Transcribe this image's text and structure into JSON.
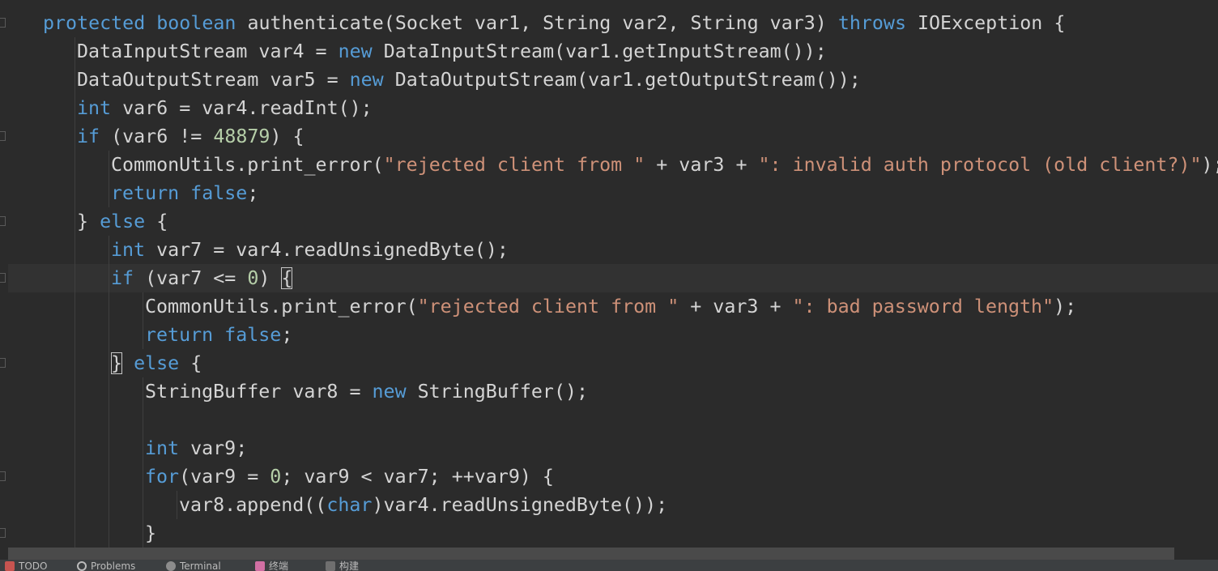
{
  "editor": {
    "lines": [
      [
        {
          "t": "protected boolean",
          "c": "kw"
        },
        {
          "t": " authenticate(Socket var1, String var2, String var3) "
        },
        {
          "t": "throws",
          "c": "kw"
        },
        {
          "t": " IOException {"
        }
      ],
      [
        {
          "t": "DataInputStream var4 = "
        },
        {
          "t": "new",
          "c": "kw"
        },
        {
          "t": " DataInputStream(var1.getInputStream());"
        }
      ],
      [
        {
          "t": "DataOutputStream var5 = "
        },
        {
          "t": "new",
          "c": "kw"
        },
        {
          "t": " DataOutputStream(var1.getOutputStream());"
        }
      ],
      [
        {
          "t": "int",
          "c": "kw"
        },
        {
          "t": " var6 = var4.readInt();"
        }
      ],
      [
        {
          "t": "if",
          "c": "kw"
        },
        {
          "t": " (var6 != "
        },
        {
          "t": "48879",
          "c": "num"
        },
        {
          "t": ") {"
        }
      ],
      [
        {
          "t": "CommonUtils.print_error("
        },
        {
          "t": "\"rejected client from \"",
          "c": "str"
        },
        {
          "t": " + var3 + "
        },
        {
          "t": "\": invalid auth protocol (old client?)\"",
          "c": "str"
        },
        {
          "t": ");"
        }
      ],
      [
        {
          "t": "return false",
          "c": "kw"
        },
        {
          "t": ";"
        }
      ],
      [
        {
          "t": "} "
        },
        {
          "t": "else",
          "c": "kw"
        },
        {
          "t": " {"
        }
      ],
      [
        {
          "t": "int",
          "c": "kw"
        },
        {
          "t": " var7 = var4.readUnsignedByte();"
        }
      ],
      [
        {
          "t": "if",
          "c": "kw"
        },
        {
          "t": " (var7 <= "
        },
        {
          "t": "0",
          "c": "num"
        },
        {
          "t": ") "
        },
        {
          "t": "{",
          "c": "brace-match"
        }
      ],
      [
        {
          "t": "CommonUtils.print_error("
        },
        {
          "t": "\"rejected client from \"",
          "c": "str"
        },
        {
          "t": " + var3 + "
        },
        {
          "t": "\": bad password length\"",
          "c": "str"
        },
        {
          "t": ");"
        }
      ],
      [
        {
          "t": "return false",
          "c": "kw"
        },
        {
          "t": ";"
        }
      ],
      [
        {
          "t": "}",
          "c": "brace-match"
        },
        {
          "t": " "
        },
        {
          "t": "else",
          "c": "kw"
        },
        {
          "t": " {"
        }
      ],
      [
        {
          "t": "StringBuffer var8 = "
        },
        {
          "t": "new",
          "c": "kw"
        },
        {
          "t": " StringBuffer();"
        }
      ],
      [],
      [
        {
          "t": "int",
          "c": "kw"
        },
        {
          "t": " var9;"
        }
      ],
      [
        {
          "t": "for",
          "c": "kw"
        },
        {
          "t": "(var9 = "
        },
        {
          "t": "0",
          "c": "num"
        },
        {
          "t": "; var9 < var7; ++var9) {"
        }
      ],
      [
        {
          "t": "var8.append(("
        },
        {
          "t": "char",
          "c": "kw"
        },
        {
          "t": ")var4.readUnsignedByte());"
        }
      ],
      [
        {
          "t": "}"
        }
      ]
    ]
  },
  "statusbar": {
    "items": [
      {
        "icon": "todo-icon",
        "label": "TODO"
      },
      {
        "icon": "problems-icon",
        "label": "Problems"
      },
      {
        "icon": "terminal-icon",
        "label": "Terminal"
      },
      {
        "icon": "build-icon",
        "label": "终端"
      },
      {
        "icon": "debug-icon",
        "label": "构建"
      }
    ]
  }
}
